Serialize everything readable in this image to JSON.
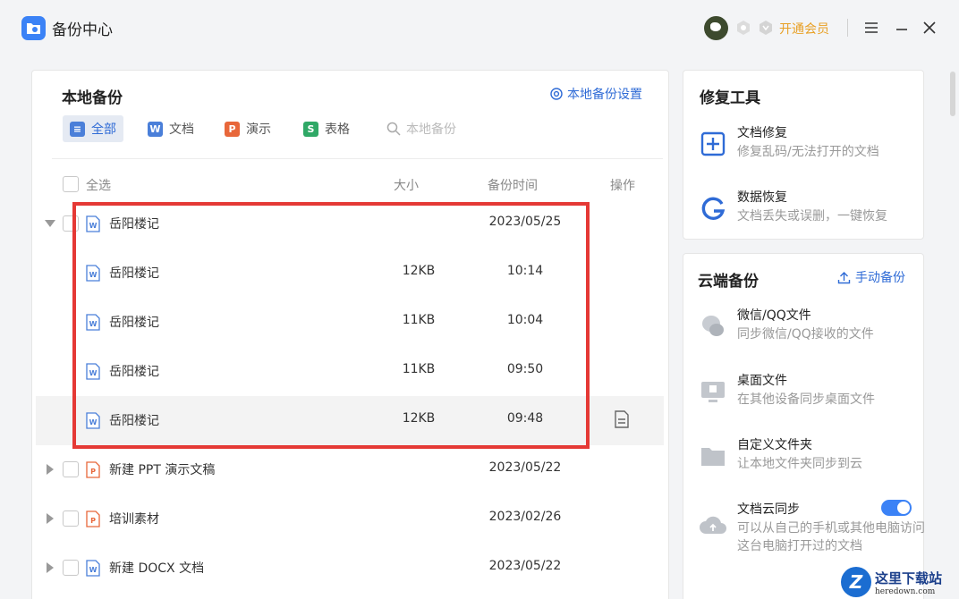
{
  "app": {
    "title": "备份中心",
    "vip_label": "开通会员"
  },
  "local": {
    "title": "本地备份",
    "settings_label": "本地备份设置",
    "filters": [
      "全部",
      "文档",
      "演示",
      "表格"
    ],
    "search_placeholder": "本地备份",
    "columns": {
      "select_all": "全选",
      "size": "大小",
      "time": "备份时间",
      "ops": "操作"
    },
    "rows": [
      {
        "name": "岳阳楼记",
        "size": "",
        "time": "2023/05/25",
        "type": "word",
        "expanded": true,
        "child": false
      },
      {
        "name": "岳阳楼记",
        "size": "12KB",
        "time": "10:14",
        "type": "word",
        "child": true
      },
      {
        "name": "岳阳楼记",
        "size": "11KB",
        "time": "10:04",
        "type": "word",
        "child": true
      },
      {
        "name": "岳阳楼记",
        "size": "11KB",
        "time": "09:50",
        "type": "word",
        "child": true
      },
      {
        "name": "岳阳楼记",
        "size": "12KB",
        "time": "09:48",
        "type": "word",
        "child": true,
        "hover": true
      },
      {
        "name": "新建 PPT 演示文稿",
        "size": "",
        "time": "2023/05/22",
        "type": "ppt",
        "child": false
      },
      {
        "name": "培训素材",
        "size": "",
        "time": "2023/02/26",
        "type": "ppt",
        "child": false
      },
      {
        "name": "新建 DOCX 文档",
        "size": "",
        "time": "2023/05/22",
        "type": "word",
        "child": false
      }
    ]
  },
  "repair": {
    "title": "修复工具",
    "tools": [
      {
        "name": "文档修复",
        "desc": "修复乱码/无法打开的文档",
        "icon": "doc-repair-icon"
      },
      {
        "name": "数据恢复",
        "desc": "文档丢失或误删，一键恢复",
        "icon": "data-recovery-icon"
      }
    ]
  },
  "cloud": {
    "title": "云端备份",
    "manual_label": "手动备份",
    "items": [
      {
        "name": "微信/QQ文件",
        "desc": "同步微信/QQ接收的文件",
        "icon": "chat-icon"
      },
      {
        "name": "桌面文件",
        "desc": "在其他设备同步桌面文件",
        "icon": "desktop-icon"
      },
      {
        "name": "自定义文件夹",
        "desc": "让本地文件夹同步到云",
        "icon": "folder-icon"
      },
      {
        "name": "文档云同步",
        "desc": "可以从自己的手机或其他电脑访问这台电脑打开过的文档",
        "icon": "cloud-sync-icon"
      }
    ],
    "sync_enabled": true
  },
  "watermark": {
    "cn": "这里下载站",
    "en": "heredown.com",
    "logo": "Z"
  },
  "colors": {
    "accent": "#2f6bd6",
    "word": "#4a7fd9",
    "ppt": "#e8673a",
    "sheet": "#2fa866",
    "highlight": "#e53935"
  }
}
